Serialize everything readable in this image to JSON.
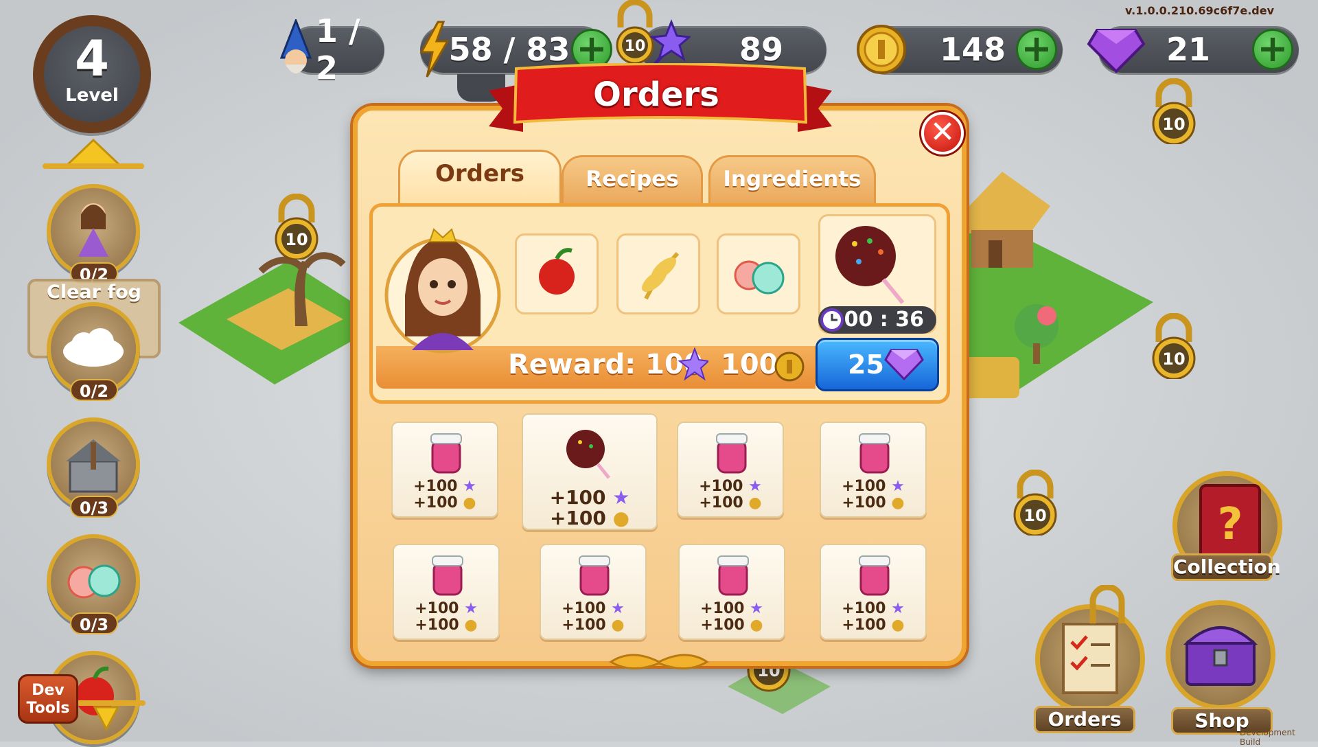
{
  "version": "v.1.0.0.210.69c6f7e.dev",
  "top_bar": {
    "wizards": "1 / 2",
    "energy": "58 / 83",
    "stars": "89",
    "coins": "148",
    "gems": "21",
    "lock_level": "10"
  },
  "level": {
    "number": "4",
    "label": "Level"
  },
  "quests": {
    "princess": "0/2",
    "clear_fog_label": "Clear fog",
    "clear_fog": "0/2",
    "well": "0/3",
    "candy": "0/3"
  },
  "dev_tools": {
    "line1": "Dev",
    "line2": "Tools"
  },
  "right_buttons": {
    "collection": "Collection",
    "orders": "Orders",
    "shop": "Shop"
  },
  "dialog": {
    "title": "Orders",
    "close": "✕",
    "tabs": [
      "Orders",
      "Recipes",
      "Ingredients"
    ],
    "current_order": {
      "reward_label": "Reward: 100",
      "reward_coins": "100",
      "timer": "00 : 36",
      "speedup_cost": "25"
    },
    "order_cards": [
      {
        "item": "jam",
        "stars": "+100",
        "coins": "+100"
      },
      {
        "item": "candy-apple",
        "stars": "+100",
        "coins": "+100",
        "selected": true
      },
      {
        "item": "jam",
        "stars": "+100",
        "coins": "+100"
      },
      {
        "item": "jam",
        "stars": "+100",
        "coins": "+100"
      },
      {
        "item": "jam",
        "stars": "+100",
        "coins": "+100"
      },
      {
        "item": "jam",
        "stars": "+100",
        "coins": "+100"
      },
      {
        "item": "jam",
        "stars": "+100",
        "coins": "+100"
      },
      {
        "item": "jam",
        "stars": "+100",
        "coins": "+100"
      }
    ]
  },
  "colors": {
    "ribbon_red": "#d81818",
    "panel_orange": "#f0a531",
    "speedup_blue": "#1f7fe6",
    "gem_purple": "#9b4fd6"
  },
  "watermark": "Development Build"
}
